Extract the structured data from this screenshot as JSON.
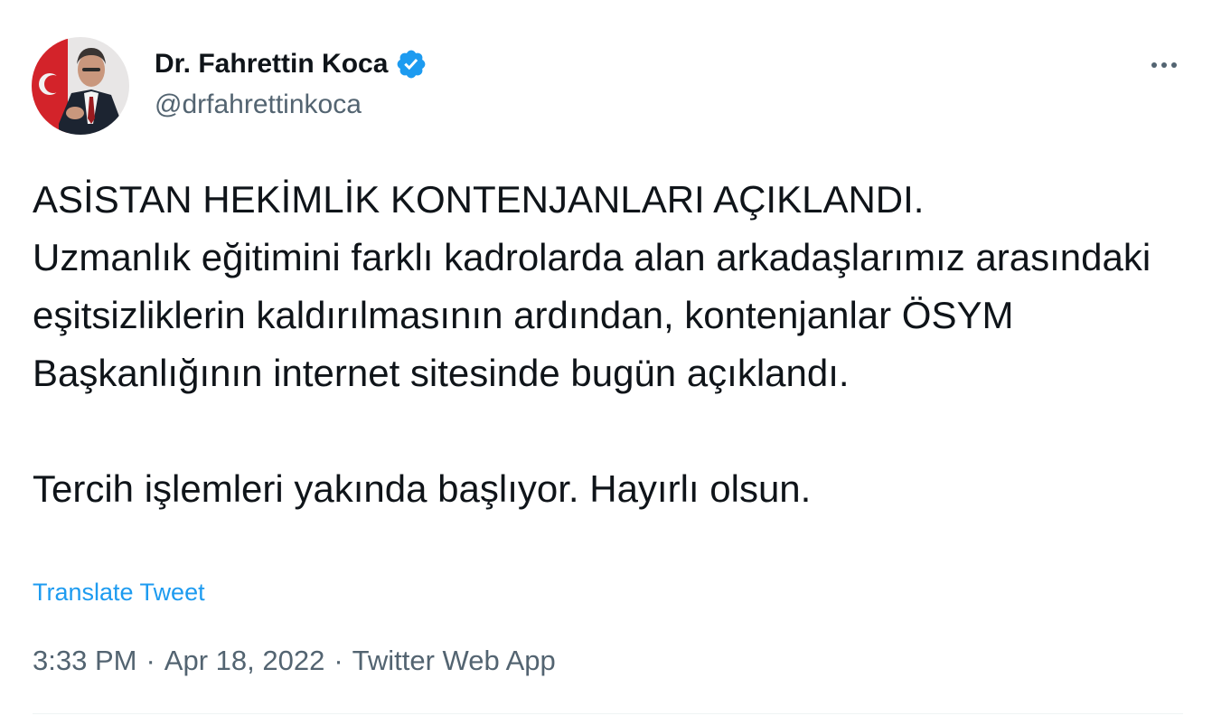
{
  "author": {
    "display_name": "Dr. Fahrettin Koca",
    "handle": "@drfahrettinkoca",
    "verified_icon": "verified-badge-icon"
  },
  "tweet": {
    "paragraphs": [
      "ASİSTAN HEKİMLİK KONTENJANLARI AÇIKLANDI.\nUzmanlık eğitimini farklı kadrolarda alan arkadaşlarımız arasındaki eşitsizliklerin kaldırılmasının ardından, kontenjanlar ÖSYM Başkanlığının internet sitesinde bugün açıklandı.",
      "Tercih işlemleri yakında başlıyor. Hayırlı olsun."
    ],
    "translate_label": "Translate Tweet",
    "time": "3:33 PM",
    "date": "Apr 18, 2022",
    "source": "Twitter Web App",
    "separator": "·"
  },
  "colors": {
    "text": "#0f1419",
    "secondary": "#536471",
    "accent": "#1d9bf0",
    "divider": "#eff3f4"
  },
  "icons": {
    "more": "more-dots-icon"
  }
}
